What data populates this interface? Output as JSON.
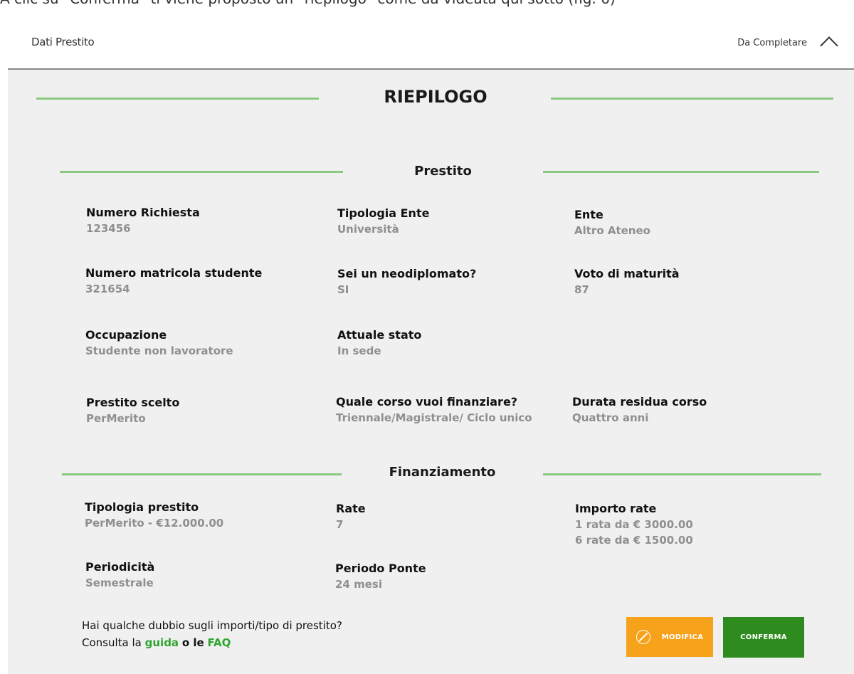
{
  "caption": "A clic su \"Conferma\" ti viene proposto un \"riepilogo\" come da videata qui sotto (fig. 6)",
  "header": {
    "title": "Dati Prestito",
    "status": "Da Completare"
  },
  "summary": {
    "title": "RIEPILOGO"
  },
  "prestito": {
    "title": "Prestito",
    "numero_richiesta": {
      "label": "Numero Richiesta",
      "value": "123456"
    },
    "tipologia_ente": {
      "label": "Tipologia Ente",
      "value": "Università"
    },
    "ente": {
      "label": "Ente",
      "value": "Altro Ateneo"
    },
    "matricola": {
      "label": "Numero matricola studente",
      "value": "321654"
    },
    "neodiplomato": {
      "label": "Sei un neodiplomato?",
      "value": "SI"
    },
    "voto": {
      "label": "Voto di maturità",
      "value": "87"
    },
    "occupazione": {
      "label": "Occupazione",
      "value": "Studente non lavoratore"
    },
    "stato": {
      "label": "Attuale stato",
      "value": "In sede"
    },
    "prestito_scelto": {
      "label": "Prestito scelto",
      "value": "PerMerito"
    },
    "corso": {
      "label": "Quale corso vuoi finanziare?",
      "value": "Triennale/Magistrale/ Ciclo unico"
    },
    "durata": {
      "label": "Durata residua corso",
      "value": "Quattro anni"
    }
  },
  "finanziamento": {
    "title": "Finanziamento",
    "tipologia": {
      "label": "Tipologia prestito",
      "value": "PerMerito - €12.000.00"
    },
    "rate": {
      "label": "Rate",
      "value": "7"
    },
    "importo": {
      "label": "Importo rate",
      "line1": "1 rata da € 3000.00",
      "line2": "6 rate da € 1500.00"
    },
    "periodicita": {
      "label": "Periodicità",
      "value": "Semestrale"
    },
    "ponte": {
      "label": "Periodo Ponte",
      "value": "24 mesi"
    }
  },
  "help": {
    "line1": "Hai qualche dubbio sugli importi/tipo di prestito?",
    "prefix": "Consulta la",
    "guida": "guida",
    "middle": "o le",
    "faq": "FAQ"
  },
  "buttons": {
    "modifica": "MODIFICA",
    "conferma": "CONFERMA"
  },
  "colors": {
    "accent_line": "#8bc97f",
    "modifica": "#f7a21b",
    "conferma": "#2e8b1e",
    "link": "#2fa52f"
  }
}
